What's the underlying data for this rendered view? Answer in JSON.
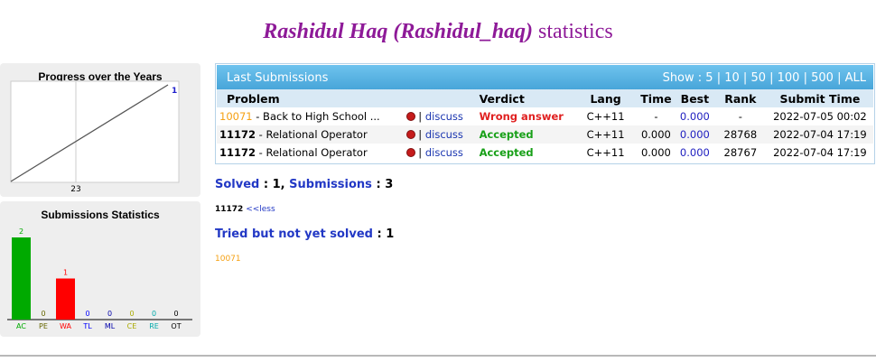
{
  "title": {
    "name": "Rashidul Haq (Rashidul_haq)",
    "suffix": "statistics"
  },
  "progress_panel": {
    "title": "Progress over the Years",
    "end_label": "1",
    "x_label": "23"
  },
  "submissions_panel": {
    "title": "Submissions Statistics"
  },
  "chart_data": [
    {
      "type": "line",
      "title": "Progress over the Years",
      "x": [
        "23"
      ],
      "series": [
        {
          "values": [
            0,
            1
          ]
        }
      ],
      "end_label": "1"
    },
    {
      "type": "bar",
      "title": "Submissions Statistics",
      "categories": [
        "AC",
        "PE",
        "WA",
        "TL",
        "ML",
        "CE",
        "RE",
        "OT"
      ],
      "values": [
        2,
        0,
        1,
        0,
        0,
        0,
        0,
        0
      ],
      "colors": [
        "#00aa00",
        "#666600",
        "#ff0000",
        "#0000ff",
        "#0000aa",
        "#aaaa00",
        "#00aaaa",
        "#000000"
      ],
      "ylim": [
        0,
        2
      ]
    }
  ],
  "last_submissions": {
    "title": "Last Submissions",
    "show_label": "Show :",
    "show_options": [
      "5",
      "10",
      "50",
      "100",
      "500",
      "ALL"
    ],
    "columns": [
      "Problem",
      "Verdict",
      "Lang",
      "Time",
      "Best",
      "Rank",
      "Submit Time"
    ],
    "discuss_label": "discuss",
    "rows": [
      {
        "num": "10071",
        "name": " - Back to High School ...",
        "verdict": "Wrong answer",
        "lang": "C++11",
        "time": "-",
        "best": "0.000",
        "rank": "-",
        "submit": "2022-07-05 00:02"
      },
      {
        "num": "11172",
        "name": " - Relational Operator",
        "verdict": "Accepted",
        "lang": "C++11",
        "time": "0.000",
        "best": "0.000",
        "rank": "28768",
        "submit": "2022-07-04 17:19"
      },
      {
        "num": "11172",
        "name": " - Relational Operator",
        "verdict": "Accepted",
        "lang": "C++11",
        "time": "0.000",
        "best": "0.000",
        "rank": "28767",
        "submit": "2022-07-04 17:19"
      }
    ]
  },
  "solved": {
    "label": "Solved",
    "value": "1",
    "subs_label": "Submissions",
    "subs_value": "3"
  },
  "solved_list": {
    "problem": "11172",
    "less": "<<less"
  },
  "tried": {
    "label": "Tried but not yet solved",
    "value": "1",
    "problem": "10071"
  }
}
